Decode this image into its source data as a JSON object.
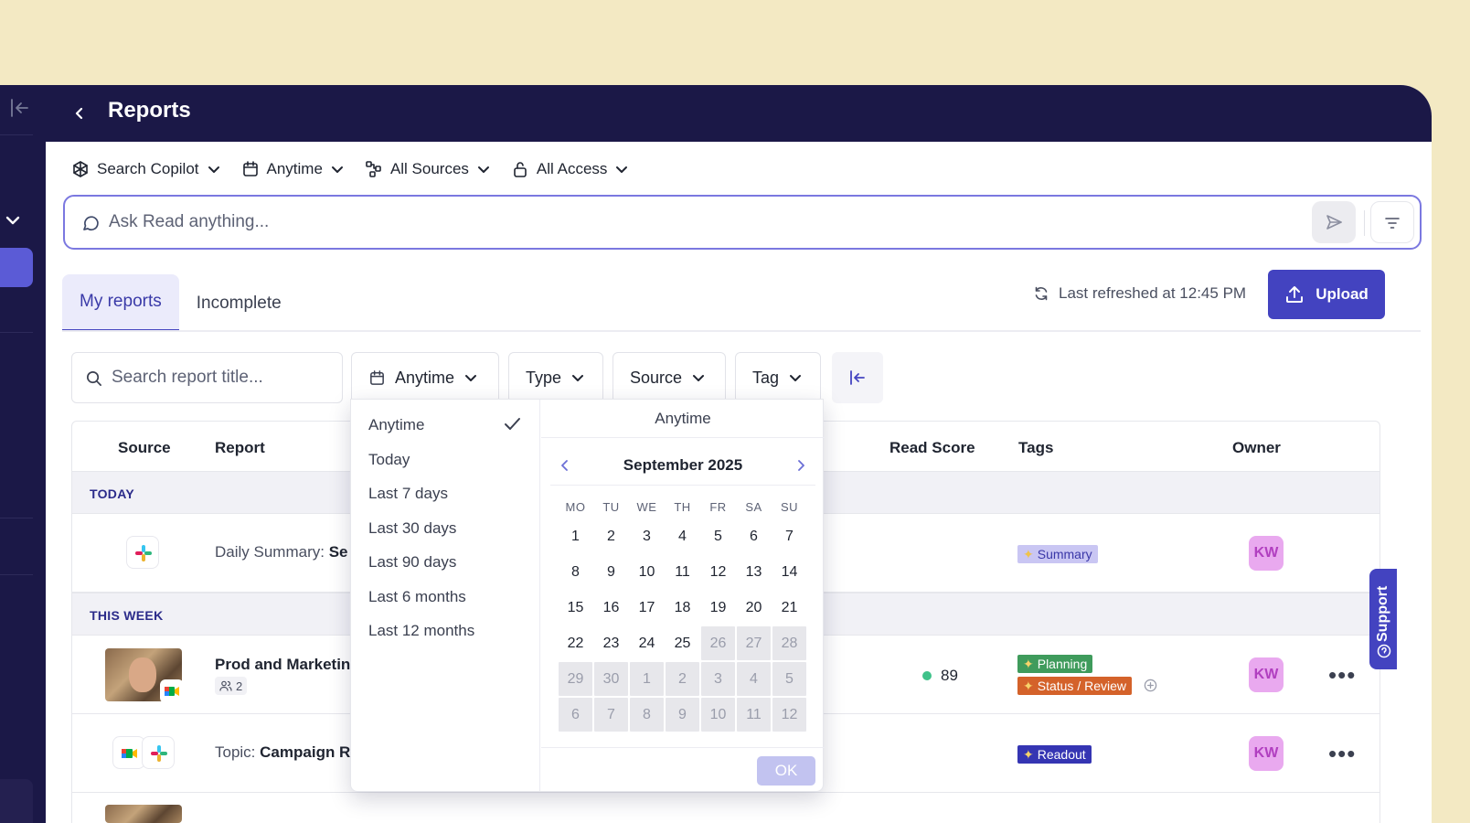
{
  "header": {
    "title": "Reports"
  },
  "scopes": [
    {
      "label": "Search Copilot",
      "icon": "copilot-icon"
    },
    {
      "label": "Anytime",
      "icon": "calendar-icon"
    },
    {
      "label": "All Sources",
      "icon": "sources-icon"
    },
    {
      "label": "All Access",
      "icon": "lock-icon"
    }
  ],
  "ask": {
    "placeholder": "Ask Read anything..."
  },
  "tabs": [
    {
      "label": "My reports"
    },
    {
      "label": "Incomplete"
    }
  ],
  "refresh": {
    "text": "Last refreshed at 12:45 PM"
  },
  "upload": {
    "label": "Upload"
  },
  "filters": {
    "search_placeholder": "Search report title...",
    "date": "Anytime",
    "type": "Type",
    "source": "Source",
    "tag": "Tag"
  },
  "table": {
    "columns": {
      "source": "Source",
      "report": "Report",
      "read_score": "Read Score",
      "tags": "Tags",
      "owner": "Owner"
    },
    "groups": {
      "today": "TODAY",
      "this_week": "THIS WEEK"
    },
    "rows": [
      {
        "prefix": "Daily Summary:",
        "title": "Se",
        "tags": [
          "Summary"
        ],
        "owner": "KW"
      },
      {
        "prefix": "",
        "title": "Prod and Marketin",
        "participants": "2",
        "score": "89",
        "tags": [
          "Planning",
          "Status / Review"
        ],
        "owner": "KW"
      },
      {
        "prefix": "Topic:",
        "title": "Campaign Re",
        "tags": [
          "Readout"
        ],
        "owner": "KW"
      }
    ]
  },
  "dropdown": {
    "options": [
      "Anytime",
      "Today",
      "Last 7 days",
      "Last 30 days",
      "Last 90 days",
      "Last 6 months",
      "Last 12 months"
    ],
    "selected": "Anytime",
    "calendar": {
      "header": "Anytime",
      "month": "September 2025",
      "dows": [
        "MO",
        "TU",
        "WE",
        "TH",
        "FR",
        "SA",
        "SU"
      ],
      "days": [
        {
          "d": "1",
          "dis": false
        },
        {
          "d": "2",
          "dis": false
        },
        {
          "d": "3",
          "dis": false
        },
        {
          "d": "4",
          "dis": false
        },
        {
          "d": "5",
          "dis": false
        },
        {
          "d": "6",
          "dis": false
        },
        {
          "d": "7",
          "dis": false
        },
        {
          "d": "8",
          "dis": false
        },
        {
          "d": "9",
          "dis": false
        },
        {
          "d": "10",
          "dis": false
        },
        {
          "d": "11",
          "dis": false
        },
        {
          "d": "12",
          "dis": false
        },
        {
          "d": "13",
          "dis": false
        },
        {
          "d": "14",
          "dis": false
        },
        {
          "d": "15",
          "dis": false
        },
        {
          "d": "16",
          "dis": false
        },
        {
          "d": "17",
          "dis": false
        },
        {
          "d": "18",
          "dis": false
        },
        {
          "d": "19",
          "dis": false
        },
        {
          "d": "20",
          "dis": false
        },
        {
          "d": "21",
          "dis": false
        },
        {
          "d": "22",
          "dis": false
        },
        {
          "d": "23",
          "dis": false
        },
        {
          "d": "24",
          "dis": false
        },
        {
          "d": "25",
          "dis": false
        },
        {
          "d": "26",
          "dis": true
        },
        {
          "d": "27",
          "dis": true
        },
        {
          "d": "28",
          "dis": true
        },
        {
          "d": "29",
          "dis": true
        },
        {
          "d": "30",
          "dis": true
        },
        {
          "d": "1",
          "dis": true
        },
        {
          "d": "2",
          "dis": true
        },
        {
          "d": "3",
          "dis": true
        },
        {
          "d": "4",
          "dis": true
        },
        {
          "d": "5",
          "dis": true
        },
        {
          "d": "6",
          "dis": true
        },
        {
          "d": "7",
          "dis": true
        },
        {
          "d": "8",
          "dis": true
        },
        {
          "d": "9",
          "dis": true
        },
        {
          "d": "10",
          "dis": true
        },
        {
          "d": "11",
          "dis": true
        },
        {
          "d": "12",
          "dis": true
        }
      ],
      "ok": "OK"
    }
  },
  "support": {
    "label": "Support"
  },
  "colors": {
    "accent": "#4343c0",
    "nav": "#1b1847",
    "background": "#f3e9c3"
  }
}
